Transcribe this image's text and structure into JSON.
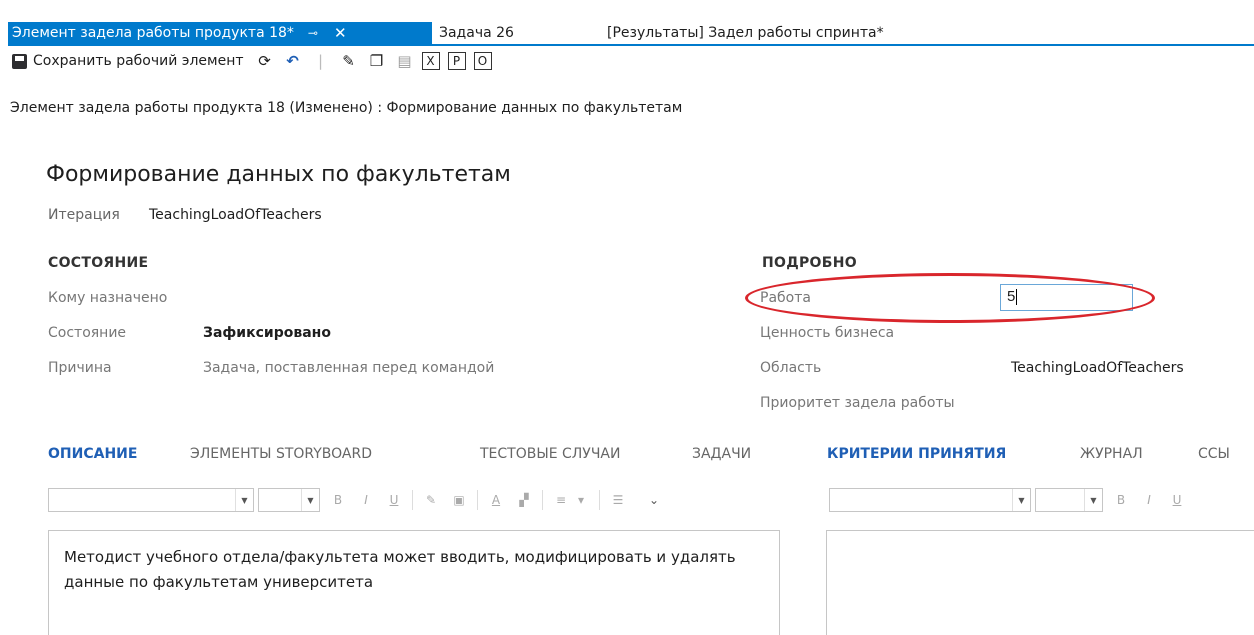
{
  "tabs": {
    "active": {
      "label": "Элемент задела работы продукта 18*",
      "pin_icon": "pin-icon",
      "close_icon": "close-icon"
    },
    "second": {
      "label": "Задача 26"
    },
    "third": {
      "label": "[Результаты] Задел работы спринта*"
    }
  },
  "toolbar": {
    "save_label": "Сохранить рабочий элемент",
    "icons": [
      "save-icon",
      "refresh-icon",
      "undo-icon",
      "link-icon",
      "copy-icon",
      "print-icon"
    ],
    "boxed": [
      "X",
      "P",
      "O"
    ]
  },
  "breadcrumb": "Элемент задела работы продукта 18 (Изменено) : Формирование данных по факультетам",
  "work_item": {
    "title": "Формирование данных по факультетам",
    "iteration_label": "Итерация",
    "iteration_value": "TeachingLoadOfTeachers"
  },
  "state_section": {
    "heading": "СОСТОЯНИЕ",
    "assigned_label": "Кому назначено",
    "assigned_value": "",
    "state_label": "Состояние",
    "state_value": "Зафиксировано",
    "reason_label": "Причина",
    "reason_value": "Задача, поставленная перед командой"
  },
  "details_section": {
    "heading": "ПОДРОБНО",
    "work_label": "Работа",
    "work_value": "5",
    "business_value_label": "Ценность бизнеса",
    "area_label": "Область",
    "area_value": "TeachingLoadOfTeachers",
    "priority_label": "Приоритет задела работы"
  },
  "left_tabs": [
    "ОПИСАНИЕ",
    "ЭЛЕМЕНТЫ STORYBOARD",
    "ТЕСТОВЫЕ СЛУЧАИ",
    "ЗАДАЧИ"
  ],
  "right_tabs": [
    "КРИТЕРИИ ПРИНЯТИЯ",
    "ЖУРНАЛ",
    "ССЫ"
  ],
  "rte": {
    "bold": "B",
    "italic": "I",
    "underline": "U",
    "font_color": "A"
  },
  "description_text": "Методист учебного отдела/факультета может вводить, модифицировать и удалять данные по факультетам университета",
  "colors": {
    "accent": "#007acc",
    "highlight": "#d9262c",
    "tab_active": "#1f5fb5"
  }
}
